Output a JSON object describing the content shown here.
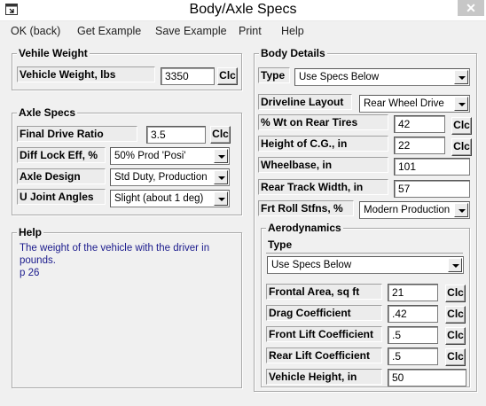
{
  "window": {
    "title": "Body/Axle Specs",
    "close_label": "✕"
  },
  "menu": [
    "OK (back)",
    "Get Example",
    "Save Example",
    "Print",
    "Help"
  ],
  "vehicle_weight": {
    "title": "Vehile Weight",
    "label": "Vehicle Weight, lbs",
    "value": "3350",
    "clc": "Clc"
  },
  "axle_specs": {
    "title": "Axle Specs",
    "final_drive_label": "Final Drive Ratio",
    "final_drive_value": "3.5",
    "clc": "Clc",
    "diff_lock_label": "Diff Lock Eff, %",
    "diff_lock_value": "50%  Prod 'Posi'",
    "axle_design_label": "Axle Design",
    "axle_design_value": "Std Duty, Production",
    "ujoint_label": "U Joint Angles",
    "ujoint_value": "Slight (about 1 deg)"
  },
  "help": {
    "title": "Help",
    "text": "The weight of the vehicle with the driver in pounds.",
    "page": "p 26"
  },
  "body_details": {
    "title": "Body Details",
    "type_label": "Type",
    "type_value": "Use Specs Below",
    "driveline_label": "Driveline Layout",
    "driveline_value": "Rear Wheel Drive",
    "wt_rear_label": "% Wt on Rear Tires",
    "wt_rear_value": "42",
    "cg_label": "Height of C.G., in",
    "cg_value": "22",
    "wheelbase_label": "Wheelbase, in",
    "wheelbase_value": "101",
    "track_label": "Rear Track Width, in",
    "track_value": "57",
    "roll_label": "Frt Roll Stfns, %",
    "roll_value": "Modern Production",
    "clc": "Clc"
  },
  "aero": {
    "title": "Aerodynamics",
    "type_label": "Type",
    "type_value": "Use Specs Below",
    "frontal_label": "Frontal Area, sq ft",
    "frontal_value": "21",
    "drag_label": "Drag Coefficient",
    "drag_value": ".42",
    "front_lift_label": "Front Lift Coefficient",
    "front_lift_value": ".5",
    "rear_lift_label": "Rear Lift Coefficient",
    "rear_lift_value": ".5",
    "height_label": "Vehicle Height, in",
    "height_value": "50",
    "clc": "Clc"
  }
}
